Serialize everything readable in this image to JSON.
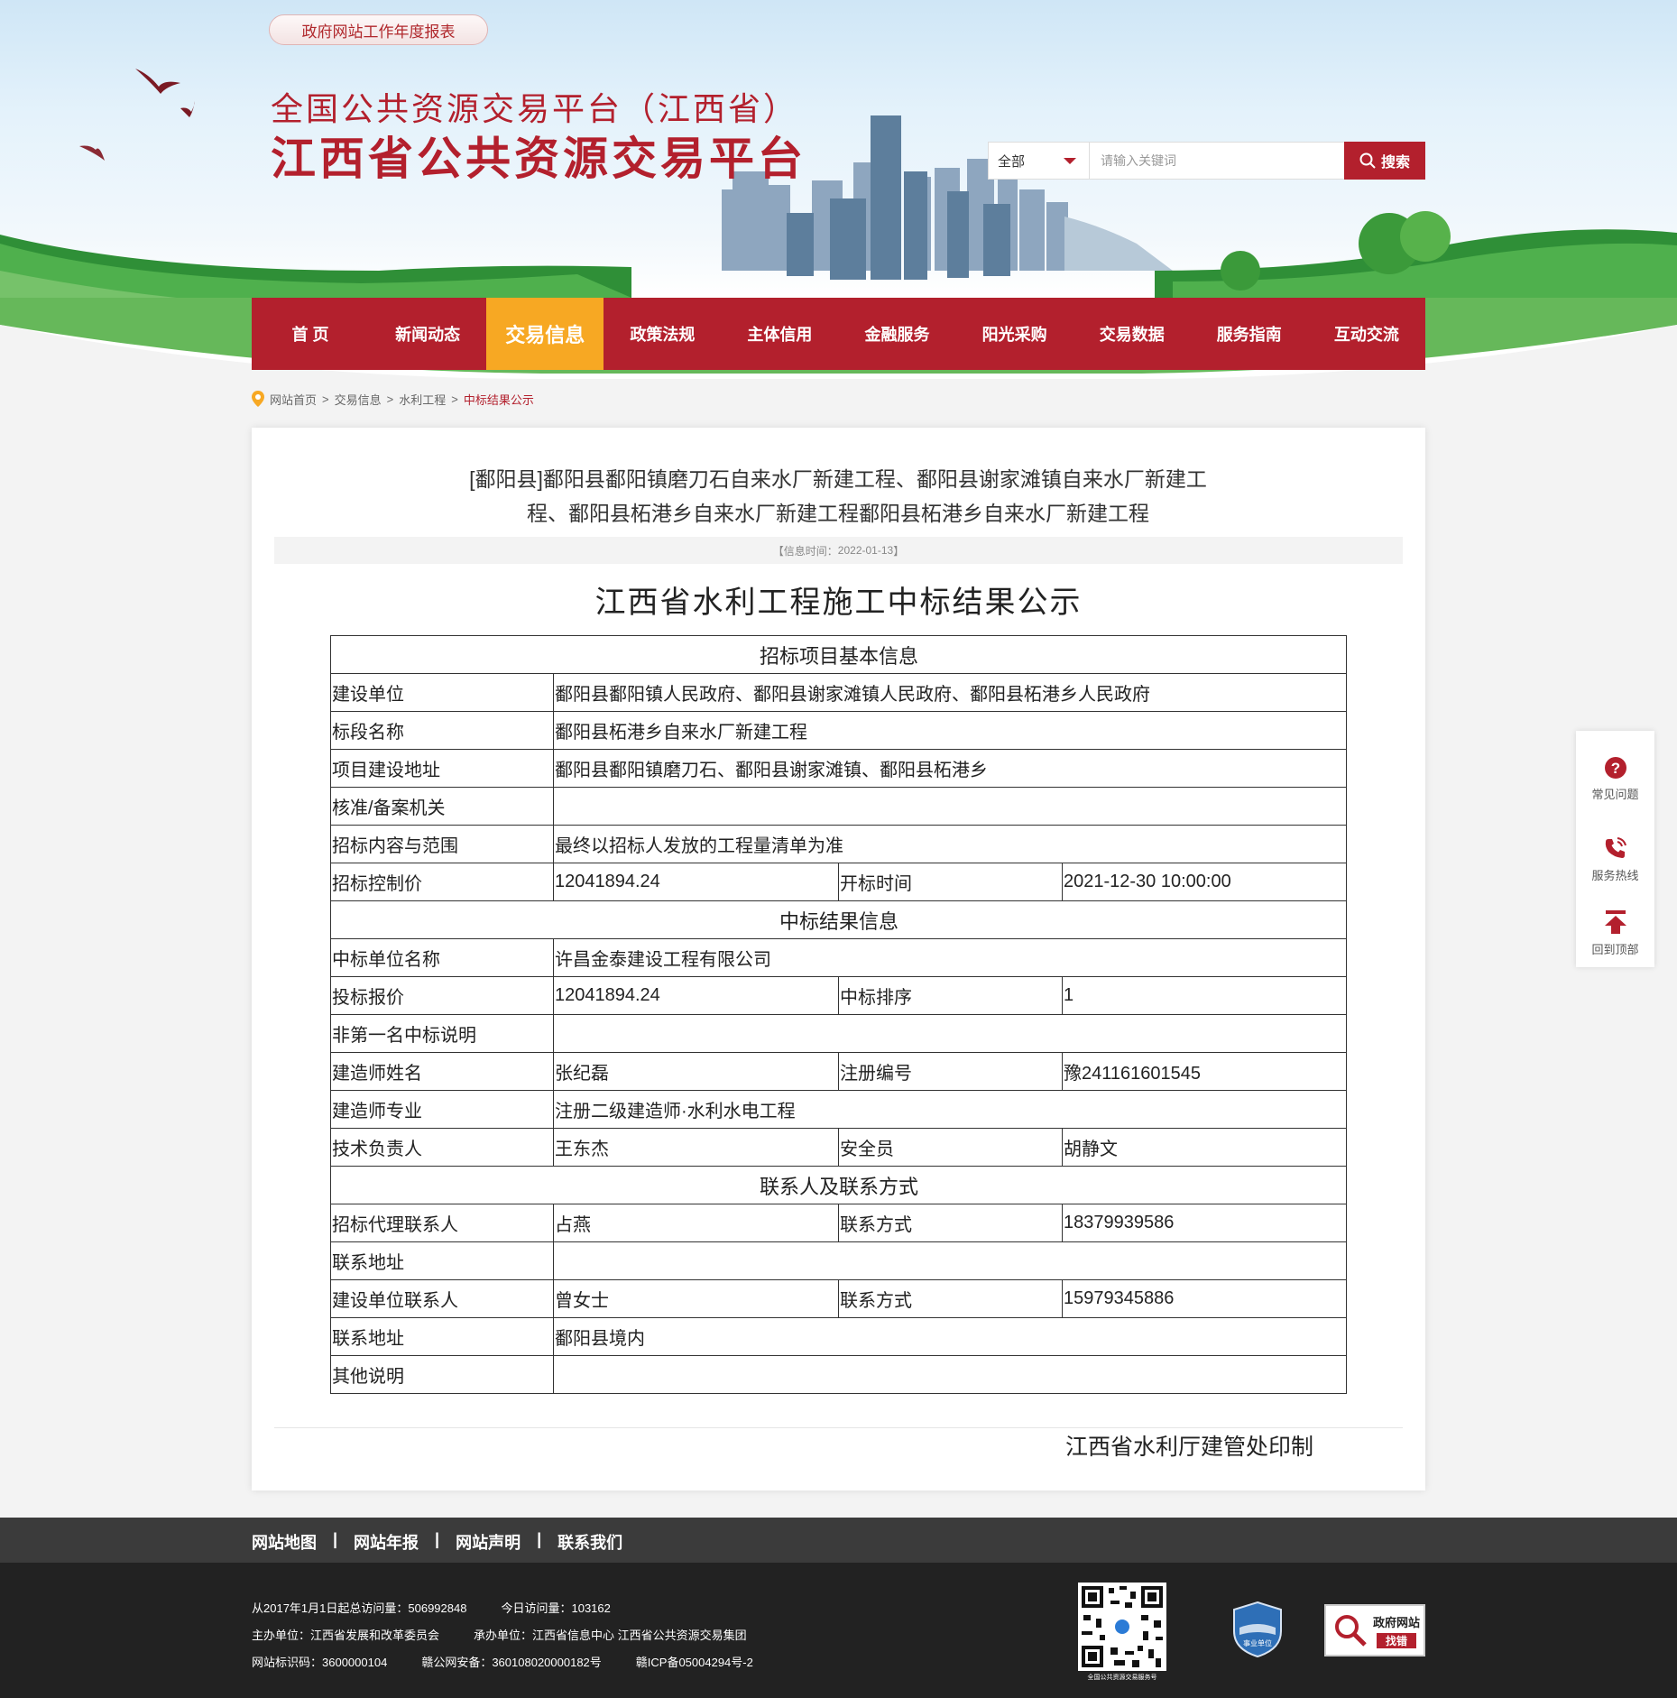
{
  "top": {
    "report_button": "政府网站工作年度报表"
  },
  "site": {
    "title_line1": "全国公共资源交易平台（江西省）",
    "title_line2": "江西省公共资源交易平台"
  },
  "search": {
    "category": "全部",
    "placeholder": "请输入关键词",
    "button": "搜索"
  },
  "nav": {
    "items": [
      "首  页",
      "新闻动态",
      "交易信息",
      "政策法规",
      "主体信用",
      "金融服务",
      "阳光采购",
      "交易数据",
      "服务指南",
      "互动交流"
    ],
    "active_index": 2
  },
  "breadcrumb": {
    "items": [
      "网站首页",
      "交易信息",
      "水利工程"
    ],
    "current": "中标结果公示"
  },
  "article": {
    "title": "[鄱阳县]鄱阳县鄱阳镇磨刀石自来水厂新建工程、鄱阳县谢家滩镇自来水厂新建工程、鄱阳县柘港乡自来水厂新建工程鄱阳县柘港乡自来水厂新建工程",
    "info_time_label": "【信息时间：",
    "info_time": "2022-01-13",
    "info_time_suffix": "】",
    "doc_title": "江西省水利工程施工中标结果公示",
    "footer_sign": "江西省水利厅建管处印制"
  },
  "table": {
    "section_basic": "招标项目基本信息",
    "basic_rows": [
      {
        "label": "建设单位",
        "value": "鄱阳县鄱阳镇人民政府、鄱阳县谢家滩镇人民政府、鄱阳县柘港乡人民政府"
      },
      {
        "label": "标段名称",
        "value": "鄱阳县柘港乡自来水厂新建工程"
      },
      {
        "label": "项目建设地址",
        "value": "鄱阳县鄱阳镇磨刀石、鄱阳县谢家滩镇、鄱阳县柘港乡"
      },
      {
        "label": "核准/备案机关",
        "value": ""
      },
      {
        "label": "招标内容与范围",
        "value": "最终以招标人发放的工程量清单为准"
      }
    ],
    "control_price_label": "招标控制价",
    "control_price": "12041894.24",
    "open_time_label": "开标时间",
    "open_time": "2021-12-30 10:00:00",
    "section_result": "中标结果信息",
    "winner_label": "中标单位名称",
    "winner": "许昌金泰建设工程有限公司",
    "bid_price_label": "投标报价",
    "bid_price": "12041894.24",
    "rank_label": "中标排序",
    "rank": "1",
    "non_first_label": "非第一名中标说明",
    "non_first": "",
    "constructor_label": "建造师姓名",
    "constructor": "张纪磊",
    "reg_no_label": "注册编号",
    "reg_no": "豫241161601545",
    "specialty_label": "建造师专业",
    "specialty": "注册二级建造师·水利水电工程",
    "tech_lead_label": "技术负责人",
    "tech_lead": "王东杰",
    "safety_label": "安全员",
    "safety": "胡静文",
    "section_contact": "联系人及联系方式",
    "agent_contact_label": "招标代理联系人",
    "agent_contact": "占燕",
    "agent_phone_label": "联系方式",
    "agent_phone": "18379939586",
    "agent_addr_label": "联系地址",
    "agent_addr": "",
    "owner_contact_label": "建设单位联系人",
    "owner_contact": "曾女士",
    "owner_phone_label": "联系方式",
    "owner_phone": "15979345886",
    "owner_addr_label": "联系地址",
    "owner_addr": "鄱阳县境内",
    "other_label": "其他说明",
    "other": ""
  },
  "side_tools": [
    {
      "label": "常见问题",
      "icon": "question-icon"
    },
    {
      "label": "服务热线",
      "icon": "phone-icon"
    },
    {
      "label": "回到顶部",
      "icon": "arrow-up-icon"
    }
  ],
  "footer": {
    "links": [
      "网站地图",
      "网站年报",
      "网站声明",
      "联系我们"
    ],
    "separator": "|",
    "visits_total_label": "从2017年1月1日起总访问量：",
    "visits_total": "506992848",
    "visits_today_label": "今日访问量：",
    "visits_today": "103162",
    "host_label": "主办单位：",
    "host": "江西省发展和改革委员会",
    "organizer_label": "承办单位：",
    "organizer": "江西省信息中心 江西省公共资源交易集团",
    "site_id_label": "网站标识码：",
    "site_id": "3600000104",
    "police_record": "赣公网安备：360108020000182号",
    "icp": "赣ICP备05004294号-2",
    "qr_caption": "全国公共资源交易服务号",
    "badge_text": "事业单位",
    "gov_badge_line1": "政府网站",
    "gov_badge_line2": "找错"
  },
  "colors": {
    "primary": "#b3202d",
    "nav_active": "#f7a823",
    "footer_top": "#3b3b3b",
    "footer_bottom": "#222222"
  }
}
